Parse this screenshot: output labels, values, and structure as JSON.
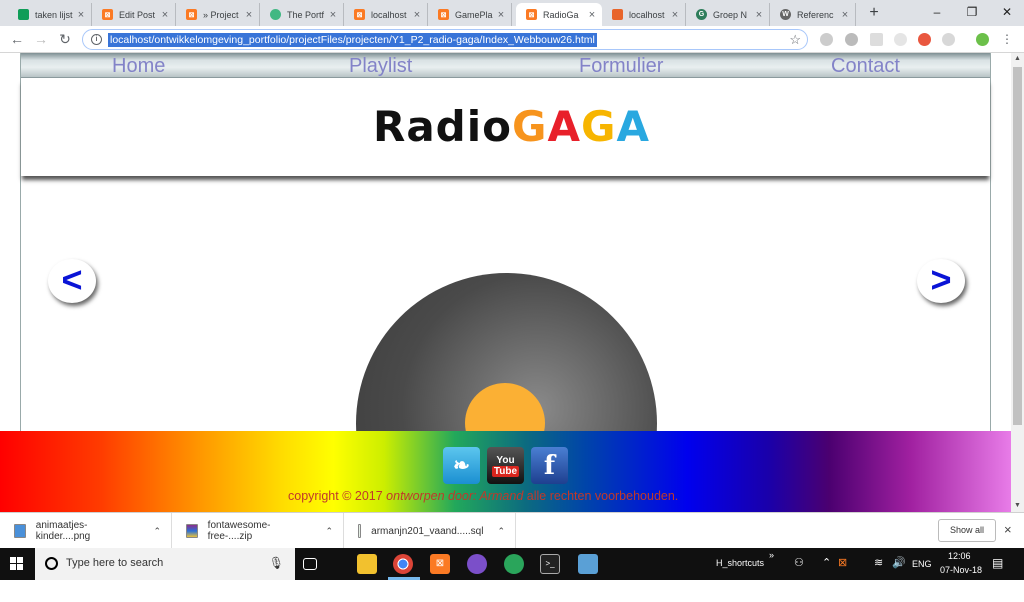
{
  "browser": {
    "tabs": [
      {
        "title": "taken lijst",
        "favicon": "sheets-icon",
        "color": "#0f9d58"
      },
      {
        "title": "Edit Post",
        "favicon": "xampp-icon",
        "color": "#fb7a24"
      },
      {
        "title": "» Project",
        "favicon": "xampp-icon",
        "color": "#fb7a24"
      },
      {
        "title": "The Portf",
        "favicon": "vue-icon",
        "color": "#41b883"
      },
      {
        "title": "localhost",
        "favicon": "xampp-icon",
        "color": "#fb7a24"
      },
      {
        "title": "GamePla",
        "favicon": "xampp-icon",
        "color": "#fb7a24"
      },
      {
        "title": "RadioGa",
        "favicon": "xampp-icon",
        "color": "#fb7a24"
      },
      {
        "title": "localhost",
        "favicon": "localhost-icon",
        "color": "#e8652b"
      },
      {
        "title": "Groep N",
        "favicon": "groep-icon",
        "color": "#2e7d5b"
      },
      {
        "title": "Referenc",
        "favicon": "wordpress-icon",
        "color": "#666666"
      }
    ],
    "url": "localhost/ontwikkelomgeving_portfolio/projectFiles/projecten/Y1_P2_radio-gaga/Index_Webbouw26.html"
  },
  "site": {
    "nav": [
      "Home",
      "Playlist",
      "Formulier",
      "Contact"
    ],
    "logo": {
      "part1": "Radio",
      "part2": [
        "G",
        "A",
        "G",
        "A"
      ]
    },
    "prev_label": "<",
    "next_label": ">",
    "footer": {
      "copyright_pre": "copyright © 2017 ",
      "copyright_em": "ontworpen door: Armand",
      "copyright_post": " alle rechten voorbehouden.",
      "social": [
        "twitter",
        "youtube",
        "facebook"
      ],
      "yt_top": "You",
      "yt_bottom": "Tube",
      "fb_letter": "f",
      "tw_glyph": "❧"
    }
  },
  "downloads": {
    "items": [
      "animaatjes-kinder....png",
      "fontawesome-free-....zip",
      "armanjn201_vaand.....sql"
    ],
    "show_all": "Show all",
    "close": "×"
  },
  "taskbar": {
    "search_placeholder": "Type here to search",
    "task_label": "H_shortcuts",
    "lang": "ENG",
    "time": "12:06",
    "date": "07-Nov-18"
  }
}
